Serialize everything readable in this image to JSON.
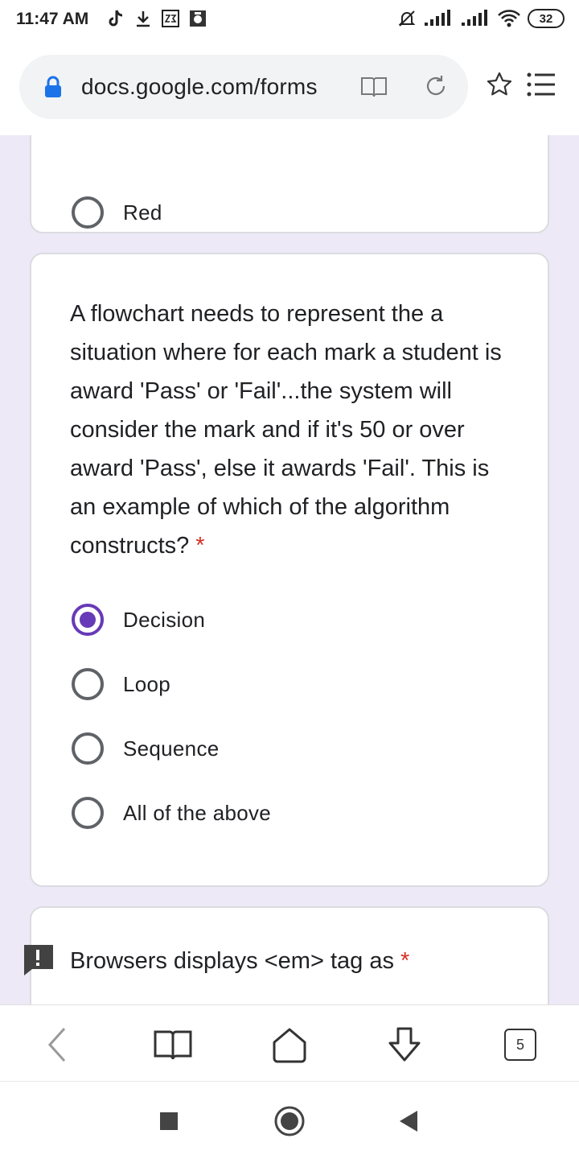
{
  "status_bar": {
    "time": "11:47 AM",
    "left_icons": [
      "tiktok-icon",
      "download-icon",
      "sim-badge-icon",
      "photo-icon"
    ],
    "right_icons": [
      "mute-icon",
      "signal-icon",
      "signal-icon",
      "wifi-icon"
    ],
    "battery": "32"
  },
  "browser": {
    "url": "docs.google.com/forms",
    "icons": [
      "lock-icon",
      "reader-mode-icon",
      "reload-icon",
      "star-icon",
      "menu-icon"
    ]
  },
  "form": {
    "prev_question": {
      "options": [
        {
          "label": "Red",
          "selected": false
        }
      ]
    },
    "question": {
      "text": "A flowchart needs to represent the a situation where for each mark a student is award 'Pass' or 'Fail'...the system will consider the mark and if it's 50 or over award 'Pass', else it awards 'Fail'. This is an example of which of the algorithm constructs?",
      "required_mark": "*",
      "options": [
        {
          "label": "Decision",
          "selected": true
        },
        {
          "label": "Loop",
          "selected": false
        },
        {
          "label": "Sequence",
          "selected": false
        },
        {
          "label": "All of the above",
          "selected": false
        }
      ]
    },
    "next_question": {
      "text": "Browsers displays <em> tag as",
      "required_mark": "*"
    },
    "accent_color": "#673ab7",
    "background_color": "#ede9f7"
  },
  "toolbar": {
    "tabs_count": "5",
    "icons": [
      "back-icon",
      "bookmarks-icon",
      "home-icon",
      "downloads-icon",
      "tabs-icon"
    ]
  },
  "navbar": {
    "icons": [
      "recents-icon",
      "home-button-icon",
      "back-triangle-icon"
    ]
  }
}
